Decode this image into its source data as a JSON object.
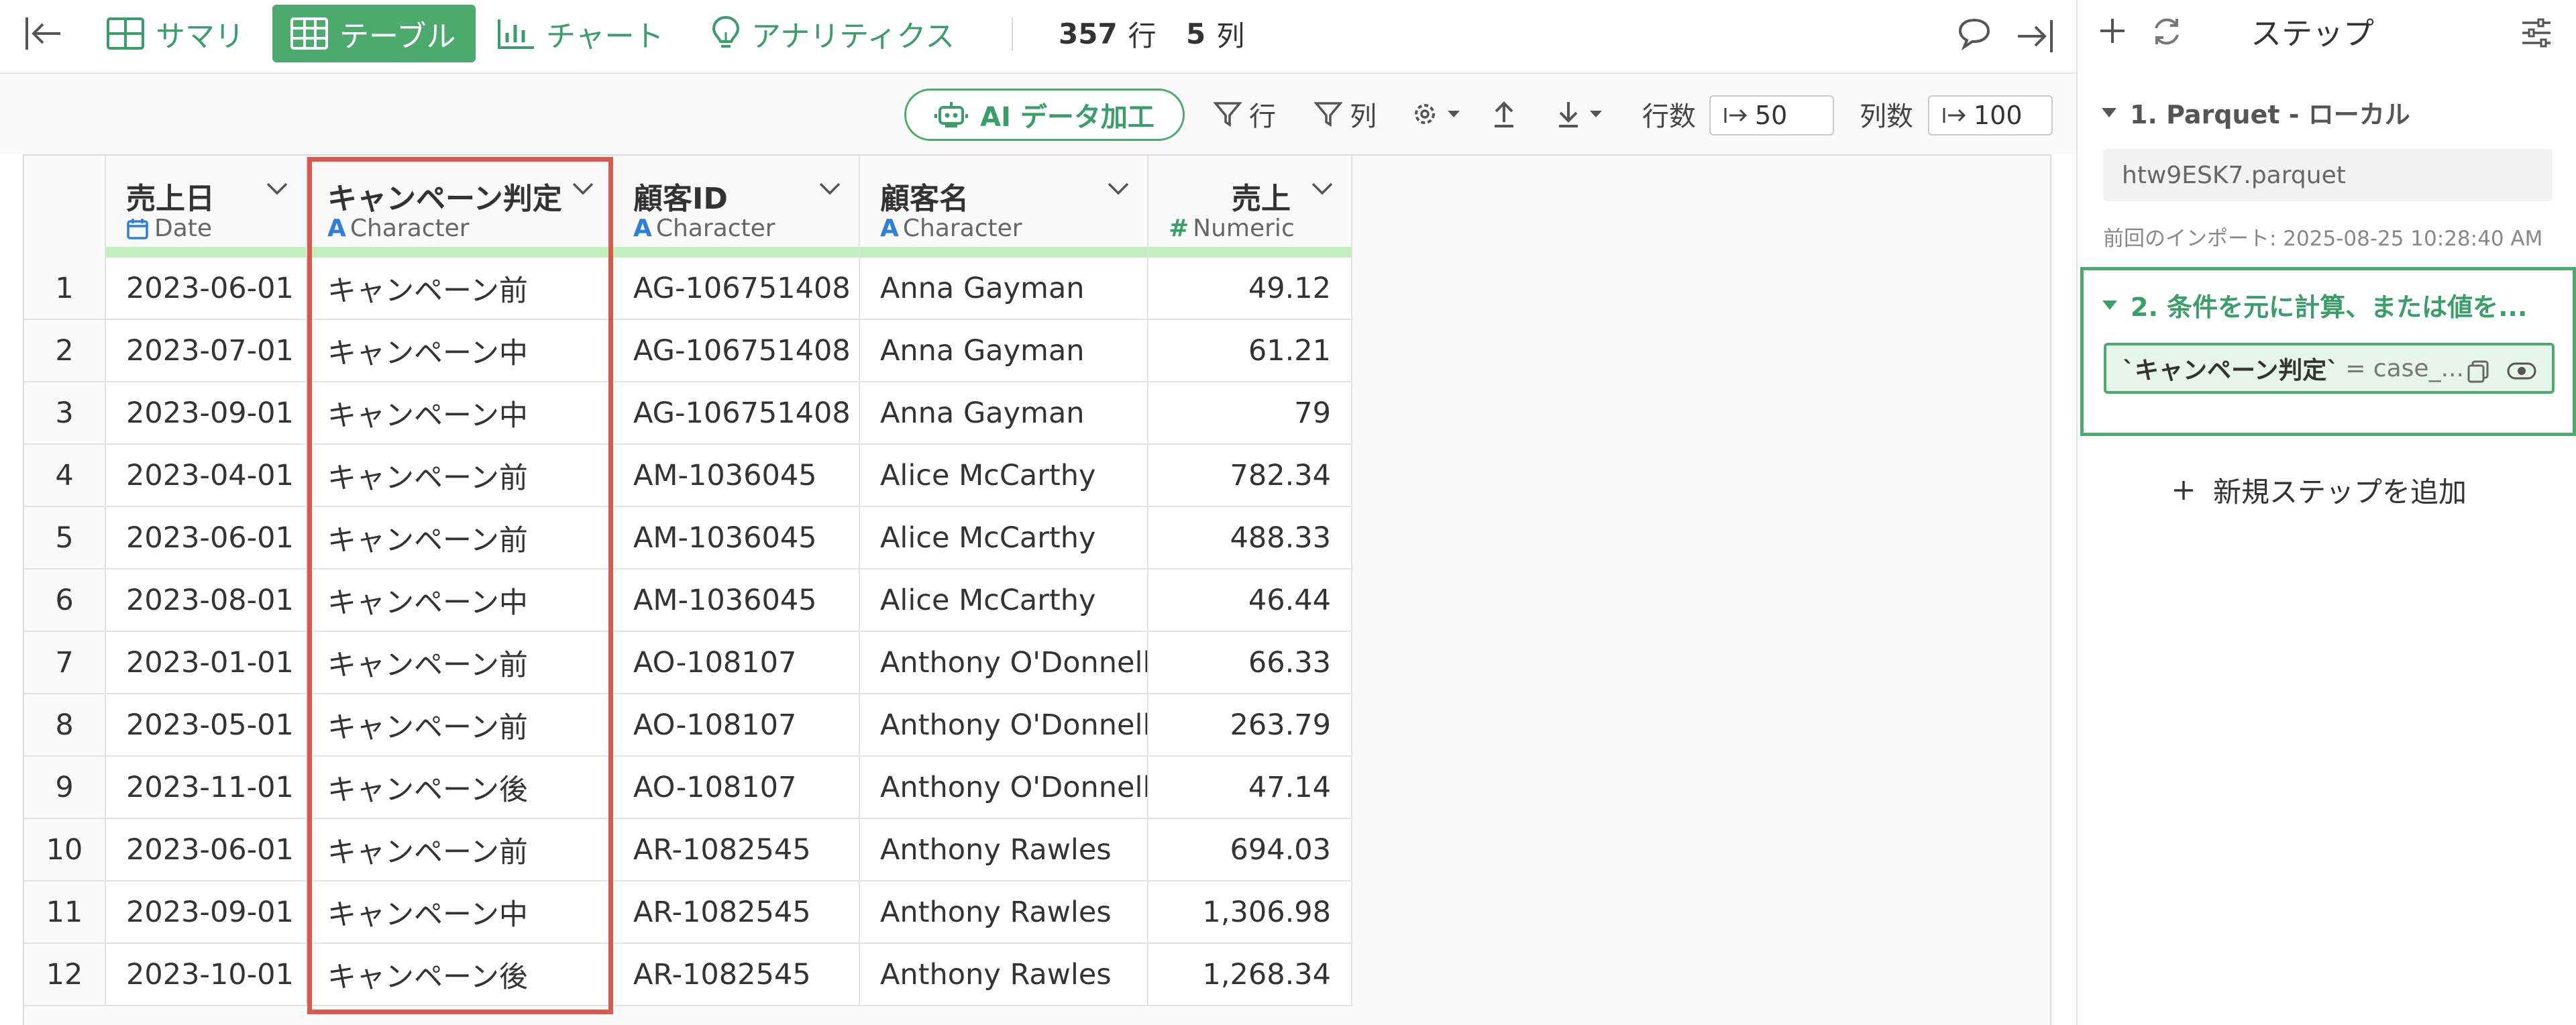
{
  "topbar": {
    "tabs": {
      "summary": "サマリ",
      "table": "テーブル",
      "chart": "チャート",
      "analytics": "アナリティクス"
    },
    "row_count": "357",
    "row_unit": "行",
    "col_count": "5",
    "col_unit": "列"
  },
  "toolbar": {
    "ai_label": "AI データ加工",
    "filter_row": "行",
    "filter_col": "列",
    "rows_label": "行数",
    "rows_value": "50",
    "cols_label": "列数",
    "cols_value": "100"
  },
  "table": {
    "columns": [
      {
        "name": "売上日",
        "type": "Date",
        "type_glyph": "calendar-icon"
      },
      {
        "name": "キャンペーン判定",
        "type": "Character",
        "type_glyph": "A"
      },
      {
        "name": "顧客ID",
        "type": "Character",
        "type_glyph": "A"
      },
      {
        "name": "顧客名",
        "type": "Character",
        "type_glyph": "A"
      },
      {
        "name": "売上",
        "type": "Numeric",
        "type_glyph": "#"
      }
    ],
    "rows": [
      {
        "i": "1",
        "date": "2023-06-01",
        "campaign": "キャンペーン前",
        "id": "AG-106751408",
        "name": "Anna Gayman",
        "sales": "49.12"
      },
      {
        "i": "2",
        "date": "2023-07-01",
        "campaign": "キャンペーン中",
        "id": "AG-106751408",
        "name": "Anna Gayman",
        "sales": "61.21"
      },
      {
        "i": "3",
        "date": "2023-09-01",
        "campaign": "キャンペーン中",
        "id": "AG-106751408",
        "name": "Anna Gayman",
        "sales": "79"
      },
      {
        "i": "4",
        "date": "2023-04-01",
        "campaign": "キャンペーン前",
        "id": "AM-1036045",
        "name": "Alice McCarthy",
        "sales": "782.34"
      },
      {
        "i": "5",
        "date": "2023-06-01",
        "campaign": "キャンペーン前",
        "id": "AM-1036045",
        "name": "Alice McCarthy",
        "sales": "488.33"
      },
      {
        "i": "6",
        "date": "2023-08-01",
        "campaign": "キャンペーン中",
        "id": "AM-1036045",
        "name": "Alice McCarthy",
        "sales": "46.44"
      },
      {
        "i": "7",
        "date": "2023-01-01",
        "campaign": "キャンペーン前",
        "id": "AO-108107",
        "name": "Anthony O'Donnell",
        "sales": "66.33"
      },
      {
        "i": "8",
        "date": "2023-05-01",
        "campaign": "キャンペーン前",
        "id": "AO-108107",
        "name": "Anthony O'Donnell",
        "sales": "263.79"
      },
      {
        "i": "9",
        "date": "2023-11-01",
        "campaign": "キャンペーン後",
        "id": "AO-108107",
        "name": "Anthony O'Donnell",
        "sales": "47.14"
      },
      {
        "i": "10",
        "date": "2023-06-01",
        "campaign": "キャンペーン前",
        "id": "AR-1082545",
        "name": "Anthony Rawles",
        "sales": "694.03"
      },
      {
        "i": "11",
        "date": "2023-09-01",
        "campaign": "キャンペーン中",
        "id": "AR-1082545",
        "name": "Anthony Rawles",
        "sales": "1,306.98"
      },
      {
        "i": "12",
        "date": "2023-10-01",
        "campaign": "キャンペーン後",
        "id": "AR-1082545",
        "name": "Anthony Rawles",
        "sales": "1,268.34"
      }
    ]
  },
  "panel": {
    "title": "ステップ",
    "step1": {
      "title": "1. Parquet - ローカル",
      "file": "htw9ESK7.parquet",
      "import_time": "前回のインポート: 2025-08-25 10:28:40 AM"
    },
    "step2": {
      "title": "2. 条件を元に計算、または値を...",
      "formula_bold": "`キャンペーン判定`",
      "formula_rest": "= case_..."
    },
    "new_step": "新規ステップを追加"
  },
  "colors": {
    "accent": "#4caa6f",
    "highlight": "#d9594c",
    "type_bar": "#c2efbd"
  }
}
